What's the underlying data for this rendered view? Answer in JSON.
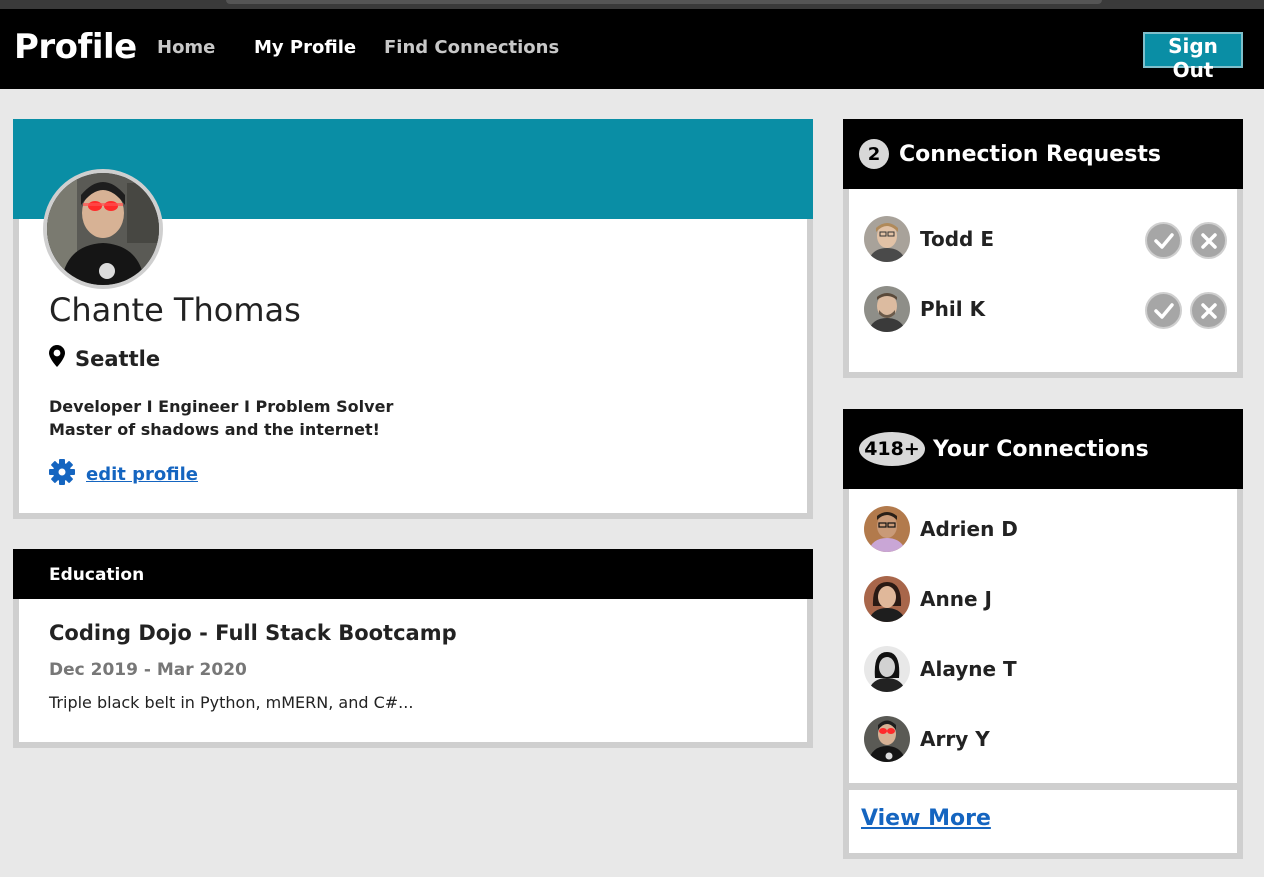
{
  "navbar": {
    "brand": "Profile",
    "links": [
      "Home",
      "My Profile",
      "Find Connections"
    ],
    "signout_label": "Sign Out"
  },
  "profile": {
    "name": "Chante Thomas",
    "location": "Seattle",
    "bio_line1": "Developer I Engineer I Problem Solver",
    "bio_line2": "Master of shadows and the internet!",
    "edit_label": "edit profile"
  },
  "education": {
    "header": "Education",
    "school": "Coding Dojo - Full Stack Bootcamp",
    "dates": "Dec 2019 - Mar 2020",
    "description": "Triple black belt in Python, mMERN, and C#..."
  },
  "requests": {
    "count": "2",
    "title": "Connection Requests",
    "people": [
      "Todd E",
      "Phil K"
    ]
  },
  "connections": {
    "count": "418+",
    "title": "Your Connections",
    "people": [
      "Adrien D",
      "Anne J",
      "Alayne T",
      "Arry Y"
    ],
    "view_more": "View More"
  },
  "colors": {
    "accent": "#0a8ea5",
    "link": "#1565c0",
    "header_bg": "#000000"
  }
}
